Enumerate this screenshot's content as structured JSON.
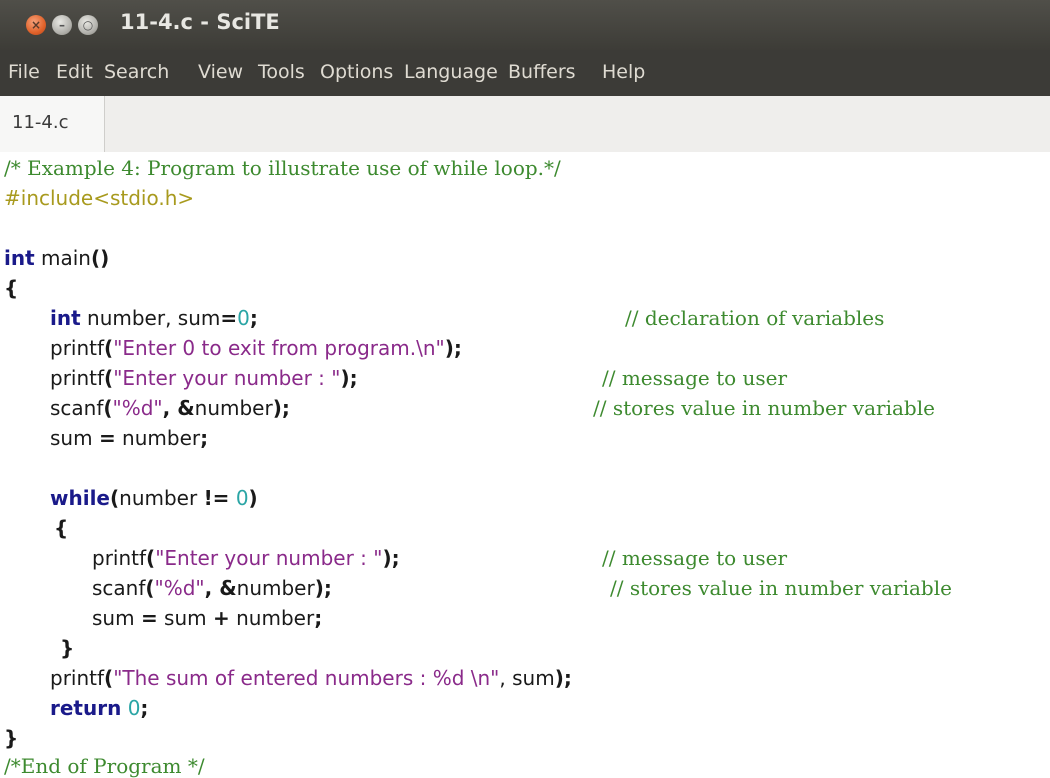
{
  "window": {
    "title": "11-4.c - SciTE",
    "buttons": {
      "close": "×",
      "minimize": "–",
      "maximize": "○"
    }
  },
  "menu": {
    "file": "File",
    "edit": "Edit",
    "search": "Search",
    "view": "View",
    "tools": "Tools",
    "options": "Options",
    "language": "Language",
    "buffers": "Buffers",
    "help": "Help"
  },
  "tabs": {
    "active": "11-4.c"
  },
  "code": {
    "l1": "/* Example 4: Program to illustrate use of while loop.*/",
    "l2": "#include<stdio.h>",
    "l4_kw": "int",
    "l4_rest": " main",
    "l4_paren": "()",
    "l5": "{",
    "l6_kw": "int",
    "l6_a": " number, sum",
    "l6_eq": "=",
    "l6_num": "0",
    "l6_semi": ";",
    "l6_comment": "// declaration of variables",
    "l7_fn": "printf",
    "l7_op": "(",
    "l7_str": "\"Enter 0 to exit from program.\\n\"",
    "l7_end": ");",
    "l8_fn": "printf",
    "l8_op": "(",
    "l8_str": "\"Enter your number : \"",
    "l8_end": ");",
    "l8_comment": "// message to user",
    "l9_fn": "scanf",
    "l9_op": "(",
    "l9_str": "\"%d\"",
    "l9_mid": ", ",
    "l9_amp": "&",
    "l9_var": "number",
    "l9_end": ");",
    "l9_comment": "// stores value in number variable",
    "l10_a": "sum ",
    "l10_eq": "=",
    "l10_b": " number",
    "l10_semi": ";",
    "l12_kw": "while",
    "l12_op": "(",
    "l12_a": "number ",
    "l12_neq": "!=",
    "l12_sp": " ",
    "l12_num": "0",
    "l12_end": ")",
    "l13": "{",
    "l14_fn": "printf",
    "l14_op": "(",
    "l14_str": "\"Enter your number : \"",
    "l14_end": ");",
    "l14_comment": "// message to user",
    "l15_fn": "scanf",
    "l15_op": "(",
    "l15_str": "\"%d\"",
    "l15_mid": ", ",
    "l15_amp": "&",
    "l15_var": "number",
    "l15_end": ");",
    "l15_comment": "// stores value in number variable",
    "l16_a": "sum ",
    "l16_eq": "=",
    "l16_b": " sum ",
    "l16_plus": "+",
    "l16_c": " number",
    "l16_semi": ";",
    "l17": "}",
    "l18_fn": "printf",
    "l18_op": "(",
    "l18_str": "\"The sum of entered numbers : %d \\n\"",
    "l18_mid": ", sum",
    "l18_end": ");",
    "l19_kw": "return",
    "l19_sp": " ",
    "l19_num": "0",
    "l19_semi": ";",
    "l20": "}",
    "l21": "/*End of Program */"
  }
}
